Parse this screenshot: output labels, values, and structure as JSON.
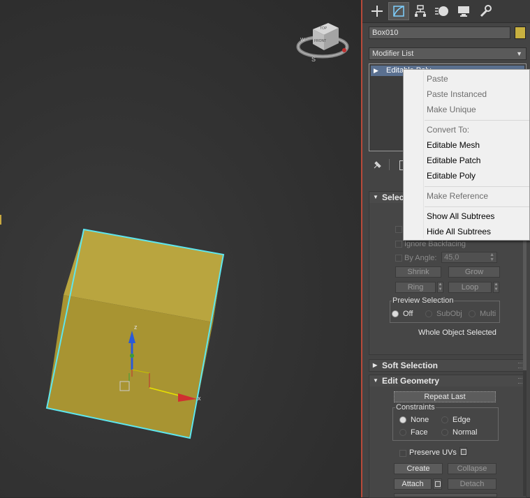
{
  "object_name": "Box010",
  "object_color": "#c8b040",
  "modifier_list_label": "Modifier List",
  "stack_item_label": "Editable Poly",
  "viewcube": {
    "top": "TOP",
    "front": "FRONT",
    "compass_s": "S",
    "compass_w": "W"
  },
  "gizmo": {
    "z_label": "z",
    "x_label": "x"
  },
  "context_menu": {
    "paste": "Paste",
    "paste_instanced": "Paste Instanced",
    "make_unique": "Make Unique",
    "convert_to": "Convert To:",
    "editable_mesh": "Editable Mesh",
    "editable_patch": "Editable Patch",
    "editable_poly": "Editable Poly",
    "make_reference": "Make Reference",
    "show_all_subtrees": "Show All Subtrees",
    "hide_all_subtrees": "Hide All Subtrees"
  },
  "selection": {
    "header": "Selection",
    "ignore_backfacing": "Ignore Backfacing",
    "by_angle": "By Angle:",
    "angle_value": "45,0",
    "shrink": "Shrink",
    "grow": "Grow",
    "ring": "Ring",
    "loop": "Loop",
    "preview_selection": "Preview Selection",
    "off": "Off",
    "subobj": "SubObj",
    "multi": "Multi",
    "status": "Whole Object Selected"
  },
  "soft_selection": {
    "header": "Soft Selection"
  },
  "edit_geometry": {
    "header": "Edit Geometry",
    "repeat_last": "Repeat Last",
    "constraints": "Constraints",
    "none": "None",
    "edge": "Edge",
    "face": "Face",
    "normal": "Normal",
    "preserve_uvs": "Preserve UVs",
    "create": "Create",
    "collapse": "Collapse",
    "attach": "Attach",
    "detach": "Detach"
  }
}
